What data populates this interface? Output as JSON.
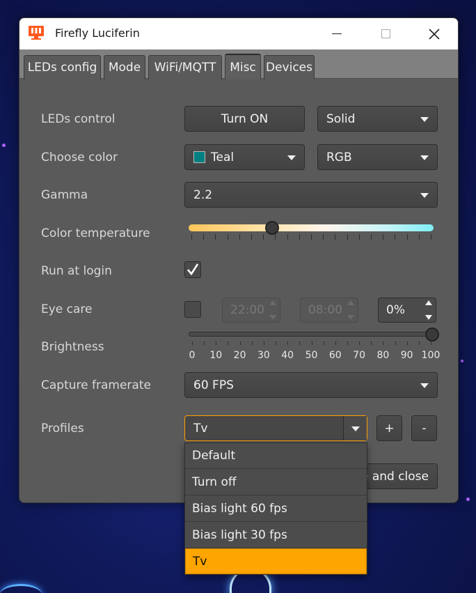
{
  "window": {
    "title": "Firefly Luciferin",
    "minimize": "—",
    "maximize": "☐",
    "close": "✕"
  },
  "tabs": [
    {
      "label": "LEDs config"
    },
    {
      "label": "Mode"
    },
    {
      "label": "WiFi/MQTT"
    },
    {
      "label": "Misc"
    },
    {
      "label": "Devices"
    }
  ],
  "active_tab": "Misc",
  "misc": {
    "leds_control": {
      "label": "LEDs control",
      "button": "Turn ON",
      "effect": "Solid"
    },
    "choose_color": {
      "label": "Choose color",
      "color": "Teal",
      "color_hex": "#008080",
      "mode": "RGB"
    },
    "gamma": {
      "label": "Gamma",
      "value": "2.2"
    },
    "color_temperature": {
      "label": "Color temperature",
      "level": 0.34
    },
    "run_at_login": {
      "label": "Run at login",
      "checked": true
    },
    "eye_care": {
      "label": "Eye care",
      "checked": false,
      "from": "22:00",
      "to": "08:00",
      "percent": "0%"
    },
    "brightness": {
      "label": "Brightness",
      "value": 100,
      "ticks": [
        "0",
        "10",
        "20",
        "30",
        "40",
        "50",
        "60",
        "70",
        "80",
        "90",
        "100"
      ]
    },
    "capture_framerate": {
      "label": "Capture framerate",
      "value": "60 FPS"
    },
    "profiles": {
      "label": "Profiles",
      "value": "Tv",
      "add": "+",
      "remove": "-",
      "options": [
        "Default",
        "Turn off",
        "Bias light 60 fps",
        "Bias light 30 fps",
        "Tv"
      ],
      "selected_index": 4
    },
    "save_close": "Save and close",
    "save_close_visible": "e and close"
  },
  "colors": {
    "accent": "#ffa500",
    "window_bg": "#5a5a5a"
  }
}
